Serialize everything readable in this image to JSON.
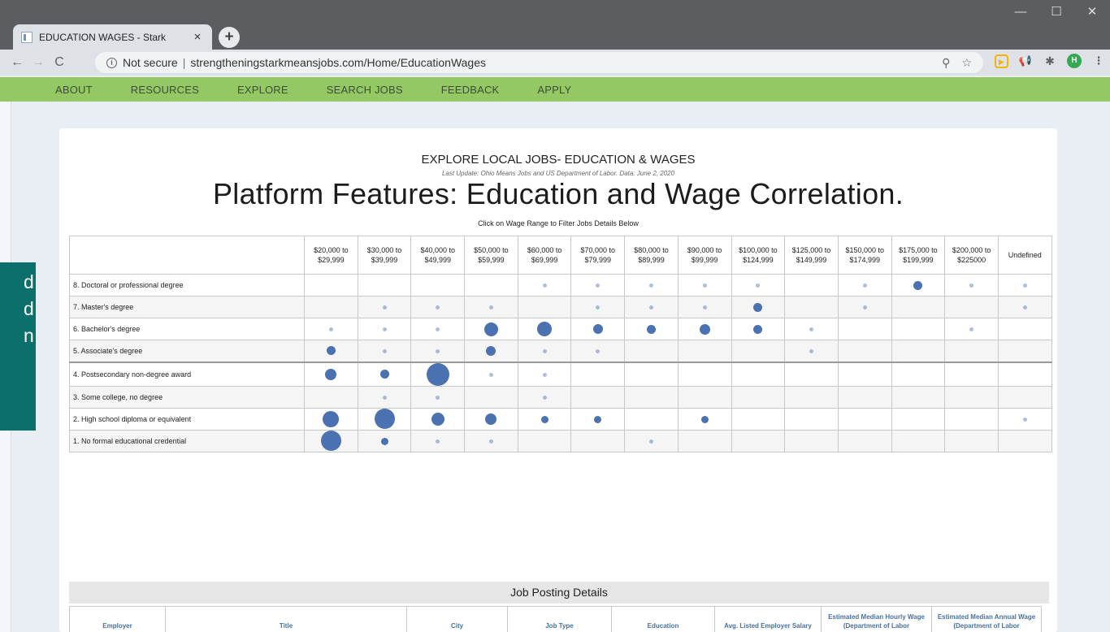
{
  "browser": {
    "tab_title": "EDUCATION WAGES - Stark",
    "tab_close": "×",
    "new_tab": "+",
    "window_controls": [
      "—",
      "☐",
      "✕"
    ],
    "url_security": "Not secure",
    "url_separator": "|",
    "url": "strengtheningstarkmeansjobs.com/Home/EducationWages",
    "back": "←",
    "forward": "→",
    "reload": "C",
    "info_icon": "ⓘ",
    "zoom_icon": "⚲",
    "star_icon": "☆",
    "avatar_initial": "H",
    "menu": "⋮"
  },
  "site_nav": [
    "ABOUT",
    "RESOURCES",
    "EXPLORE",
    "SEARCH JOBS",
    "FEEDBACK",
    "APPLY"
  ],
  "overlay": {
    "lines": [
      "d",
      "d",
      "",
      "",
      "n"
    ]
  },
  "page": {
    "title": "EXPLORE LOCAL JOBS- EDUCATION & WAGES",
    "subtitle": "Last Update: Ohio Means Jobs and US Department of Labor. Data: June 2, 2020",
    "caption": "Platform Features: Education and Wage Correlation.",
    "hint": "Click on Wage Range to Filter Jobs Details Below"
  },
  "chart_data": {
    "type": "table",
    "columns": [
      [
        "$20,000 to",
        "$29,999"
      ],
      [
        "$30,000 to",
        "$39,999"
      ],
      [
        "$40,000 to",
        "$49,999"
      ],
      [
        "$50,000 to",
        "$59,999"
      ],
      [
        "$60,000 to",
        "$69,999"
      ],
      [
        "$70,000 to",
        "$79,999"
      ],
      [
        "$80,000 to",
        "$89,999"
      ],
      [
        "$90,000 to",
        "$99,999"
      ],
      [
        "$100,000 to",
        "$124,999"
      ],
      [
        "$125,000 to",
        "$149,999"
      ],
      [
        "$150,000 to",
        "$174,999"
      ],
      [
        "$175,000 to",
        "$199,999"
      ],
      [
        "$200,000 to",
        "$225000"
      ],
      [
        "Undefined"
      ]
    ],
    "rows": [
      {
        "label": "8. Doctoral or professional degree",
        "dots": [
          0,
          0,
          0,
          0,
          1,
          1,
          1,
          1,
          1,
          0,
          1,
          4,
          1,
          1
        ]
      },
      {
        "label": "7. Master's degree",
        "dots": [
          0,
          1,
          1,
          1,
          0,
          1,
          1,
          1,
          4,
          0,
          1,
          0,
          0,
          1
        ]
      },
      {
        "label": "6. Bachelor's degree",
        "dots": [
          1,
          1,
          1,
          10,
          12,
          5,
          4,
          6,
          4,
          1,
          0,
          0,
          1,
          0
        ]
      },
      {
        "label": "5. Associate's degree",
        "dots": [
          4,
          1,
          1,
          5,
          1,
          1,
          0,
          0,
          0,
          1,
          0,
          0,
          0,
          0
        ]
      },
      {
        "label": "4. Postsecondary non-degree award",
        "dots": [
          7,
          4,
          28,
          1,
          1,
          0,
          0,
          0,
          0,
          0,
          0,
          0,
          0,
          0
        ]
      },
      {
        "label": "3. Some college, no degree",
        "dots": [
          0,
          1,
          1,
          0,
          1,
          0,
          0,
          0,
          0,
          0,
          0,
          0,
          0,
          0
        ]
      },
      {
        "label": "2. High school diploma or equivalent",
        "dots": [
          15,
          22,
          9,
          7,
          3,
          3,
          0,
          3,
          0,
          0,
          0,
          0,
          0,
          1
        ]
      },
      {
        "label": "1. No formal educational credential",
        "dots": [
          22,
          3,
          1,
          1,
          0,
          0,
          1,
          0,
          0,
          0,
          0,
          0,
          0,
          0
        ]
      }
    ]
  },
  "jobs": {
    "header": "Job Posting Details",
    "columns": [
      "Employer",
      "Title",
      "City",
      "Job Type",
      "Education",
      "Avg. Listed Employer Salary",
      "Estimated Median Hourly Wage (Department of Labor",
      "Estimated Median Annual Wage (Department of Labor"
    ]
  },
  "colors": {
    "nav_green": "#93c864",
    "dot_blue": "#4b72b0",
    "teal_overlay": "#0b6f6b"
  }
}
